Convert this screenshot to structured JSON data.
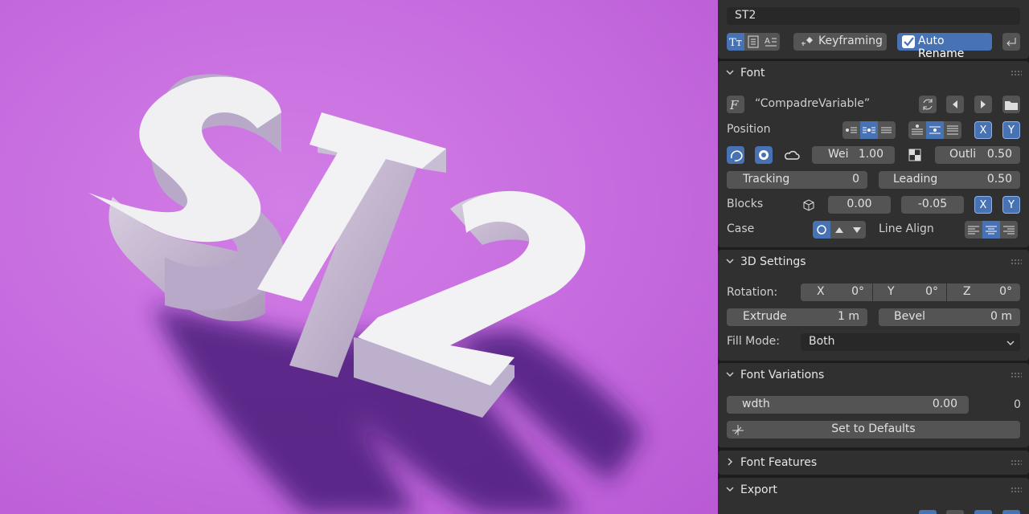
{
  "object_name": "ST2",
  "toolbar": {
    "keyframing_label": "Keyframing",
    "auto_rename_label": "Auto Rename"
  },
  "font": {
    "title": "Font",
    "font_name": "“CompadreVariable”",
    "position_label": "Position",
    "x_label": "X",
    "y_label": "Y",
    "weight_label": "Wei",
    "weight_value": "1.00",
    "outline_label": "Outli",
    "outline_value": "0.50",
    "tracking_label": "Tracking",
    "tracking_value": "0",
    "leading_label": "Leading",
    "leading_value": "0.50",
    "blocks_label": "Blocks",
    "blocks_x": "0.00",
    "blocks_y": "-0.05",
    "case_label": "Case",
    "line_align_label": "Line Align"
  },
  "settings3d": {
    "title": "3D Settings",
    "rotation_label": "Rotation:",
    "rot_x_label": "X",
    "rot_x": "0°",
    "rot_y_label": "Y",
    "rot_y": "0°",
    "rot_z_label": "Z",
    "rot_z": "0°",
    "extrude_label": "Extrude",
    "extrude_value": "1 m",
    "bevel_label": "Bevel",
    "bevel_value": "0 m",
    "fill_mode_label": "Fill Mode:",
    "fill_mode_value": "Both"
  },
  "variations": {
    "title": "Font Variations",
    "axis_label": "wdth",
    "axis_value": "0.00",
    "axis_side_value": "0",
    "defaults_label": "Set to Defaults"
  },
  "features": {
    "title": "Font Features"
  },
  "export": {
    "title": "Export"
  },
  "viewport_text": "ST2",
  "colors": {
    "background": "#c96ee0",
    "panel": "#303030",
    "accent": "#4772b3"
  }
}
